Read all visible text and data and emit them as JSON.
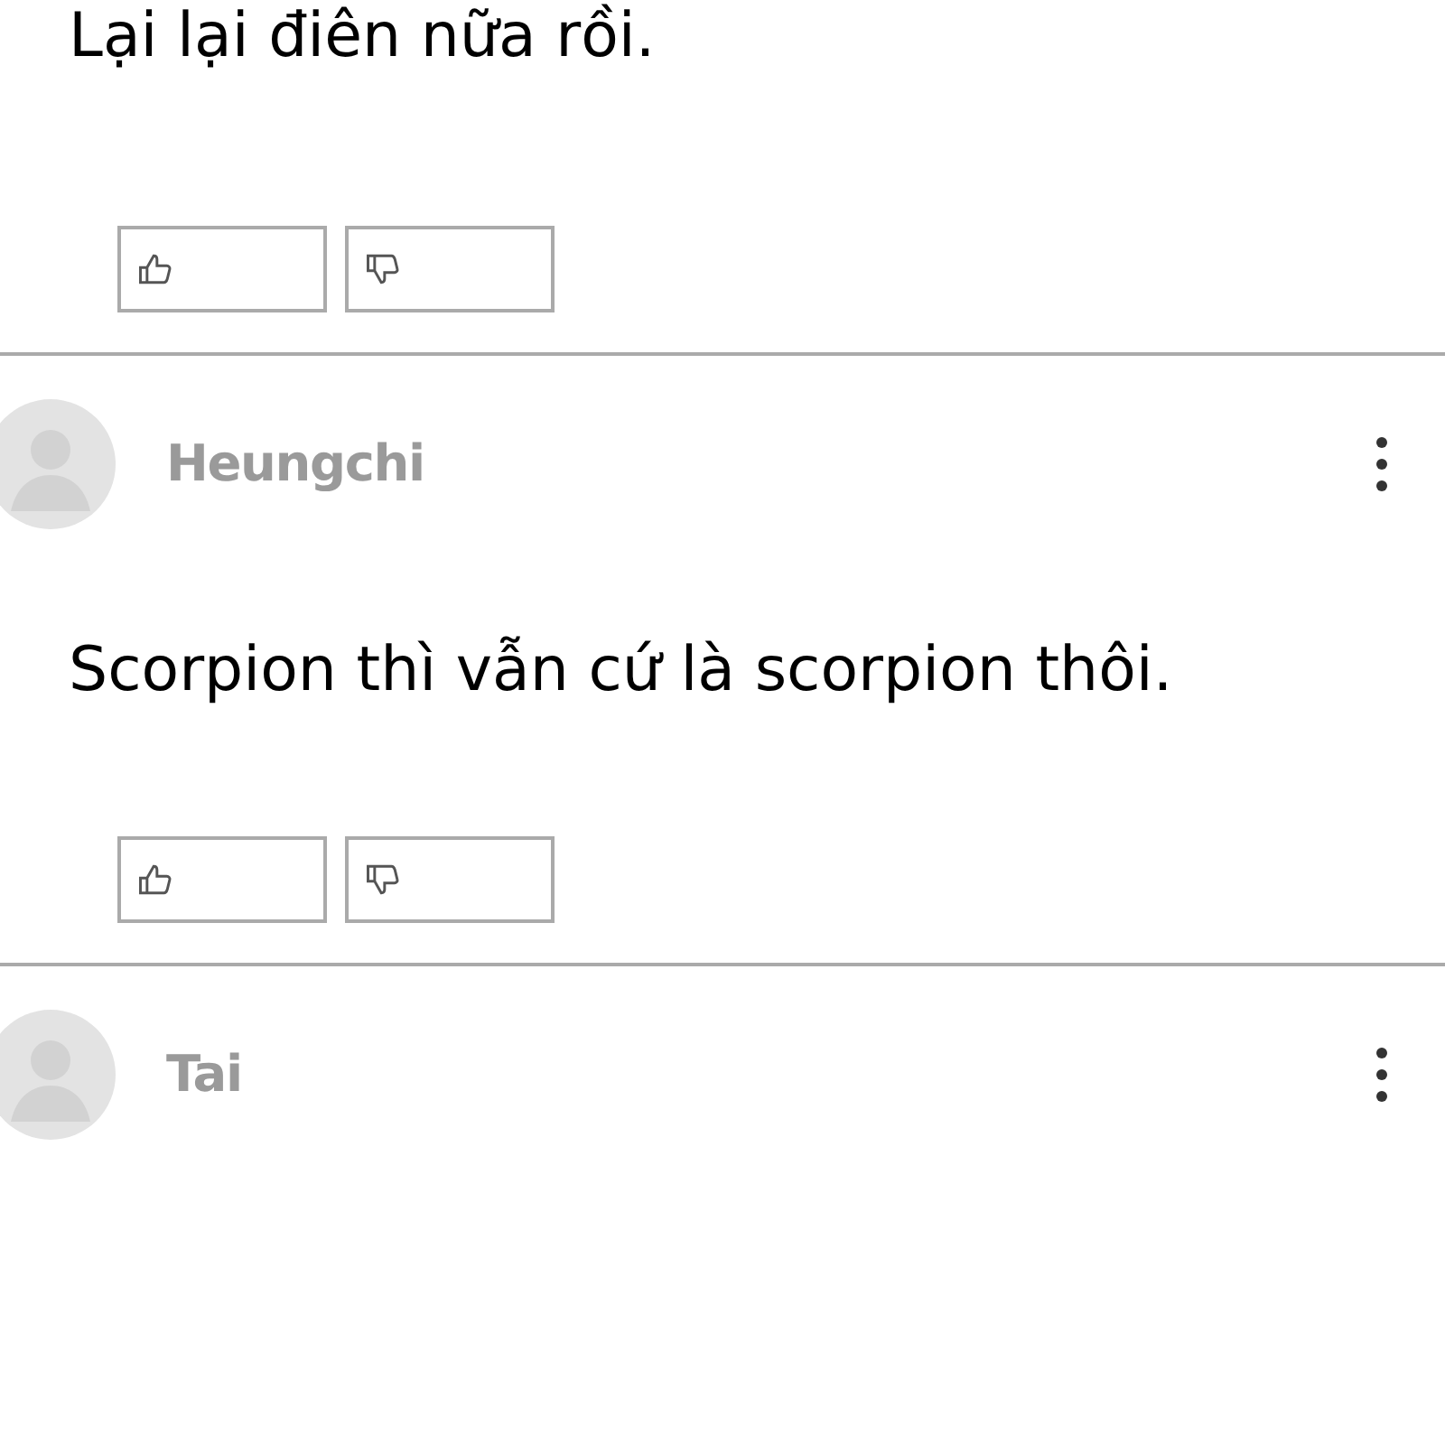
{
  "comments": [
    {
      "text": "Lại lại điên nữa rồi."
    },
    {
      "author": "Heungchi",
      "text": "Scorpion thì vẫn cứ là scorpion thôi."
    },
    {
      "author": "Tai"
    }
  ]
}
